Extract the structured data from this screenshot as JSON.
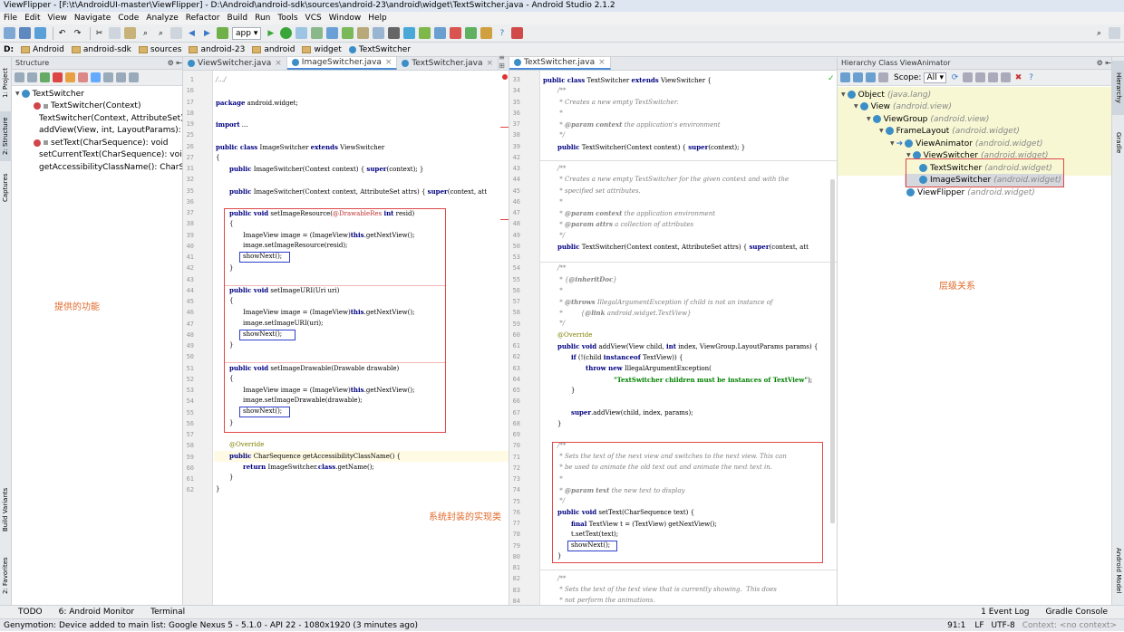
{
  "window": {
    "title": "ViewFlipper - [F:\\t\\AndroidUI-master\\ViewFlipper] - D:\\Android\\android-sdk\\sources\\android-23\\android\\widget\\TextSwitcher.java - Android Studio 2.1.2"
  },
  "menu": [
    "File",
    "Edit",
    "View",
    "Navigate",
    "Code",
    "Analyze",
    "Refactor",
    "Build",
    "Run",
    "Tools",
    "VCS",
    "Window",
    "Help"
  ],
  "toolbar": {
    "run_config": "app"
  },
  "breadcrumb": [
    "D:",
    "Android",
    "android-sdk",
    "sources",
    "android-23",
    "android",
    "widget",
    "TextSwitcher"
  ],
  "left_strip": {
    "project": "1: Project",
    "structure": "2: Structure",
    "captures": "Captures",
    "build_variants": "Build Variants",
    "favorites": "2: Favorites"
  },
  "right_strip": {
    "hierarchy": "Hierarchy",
    "gradle": "Gradle",
    "android_model": "Android Model"
  },
  "structure": {
    "title": "Structure",
    "root": "TextSwitcher",
    "items": [
      "TextSwitcher(Context)",
      "TextSwitcher(Context, AttributeSet)",
      "addView(View, int, LayoutParams): void",
      "setText(CharSequence): void",
      "setCurrentText(CharSequence): void",
      "getAccessibilityClassName(): CharSequence"
    ]
  },
  "editor_tabs": [
    {
      "label": "ViewSwitcher.java"
    },
    {
      "label": "ImageSwitcher.java"
    },
    {
      "label": "TextSwitcher.java"
    }
  ],
  "right_editor_tab": "TextSwitcher.java",
  "left_code": {
    "line_numbers": [
      "1",
      "16",
      "17",
      "18",
      "19",
      "25",
      "26",
      "27",
      "31",
      "32",
      "35",
      "36",
      "37",
      "38",
      "39",
      "40",
      "41",
      "42",
      "43",
      "44",
      "45",
      "46",
      "47",
      "48",
      "49",
      "50",
      "51",
      "52",
      "53",
      "54",
      "55",
      "56",
      "57",
      "58",
      "59",
      "60",
      "61",
      "62"
    ]
  },
  "right_code": {
    "line_numbers": [
      "33",
      "34",
      "35",
      "36",
      "37",
      "38",
      "39",
      "42",
      "43",
      "44",
      "45",
      "46",
      "47",
      "48",
      "49",
      "50",
      "53",
      "54",
      "55",
      "56",
      "57",
      "58",
      "59",
      "60",
      "61",
      "62",
      "63",
      "64",
      "65",
      "66",
      "67",
      "68",
      "69",
      "70",
      "71",
      "72",
      "73",
      "74",
      "75",
      "76",
      "77",
      "78",
      "79",
      "80",
      "81",
      "82",
      "83",
      "84"
    ]
  },
  "hierarchy": {
    "title": "Hierarchy Class ViewAnimator",
    "scope_label": "Scope:",
    "scope_value": "All",
    "nodes": [
      {
        "name": "Object",
        "pkg": "(java.lang)"
      },
      {
        "name": "View",
        "pkg": "(android.view)"
      },
      {
        "name": "ViewGroup",
        "pkg": "(android.view)"
      },
      {
        "name": "FrameLayout",
        "pkg": "(android.widget)"
      },
      {
        "name": "ViewAnimator",
        "pkg": "(android.widget)"
      },
      {
        "name": "ViewSwitcher",
        "pkg": "(android.widget)"
      },
      {
        "name": "TextSwitcher",
        "pkg": "(android.widget)"
      },
      {
        "name": "ImageSwitcher",
        "pkg": "(android.widget)"
      },
      {
        "name": "ViewFlipper",
        "pkg": "(android.widget)"
      }
    ]
  },
  "annotations": {
    "features": "提供的功能",
    "impl": "系统封装的实现类",
    "hierarchy": "层级关系"
  },
  "bottom_tabs": [
    "TODO",
    "6: Android Monitor",
    "Terminal"
  ],
  "bottom_right": [
    "1 Event Log",
    "Gradle Console"
  ],
  "status": {
    "message": "Genymotion: Device added to main list: Google Nexus 5 - 5.1.0 - API 22 - 1080x1920 (3 minutes ago)",
    "position": "91:1",
    "line_sep": "LF",
    "encoding": "UTF-8",
    "context": "Context: <no context>"
  }
}
